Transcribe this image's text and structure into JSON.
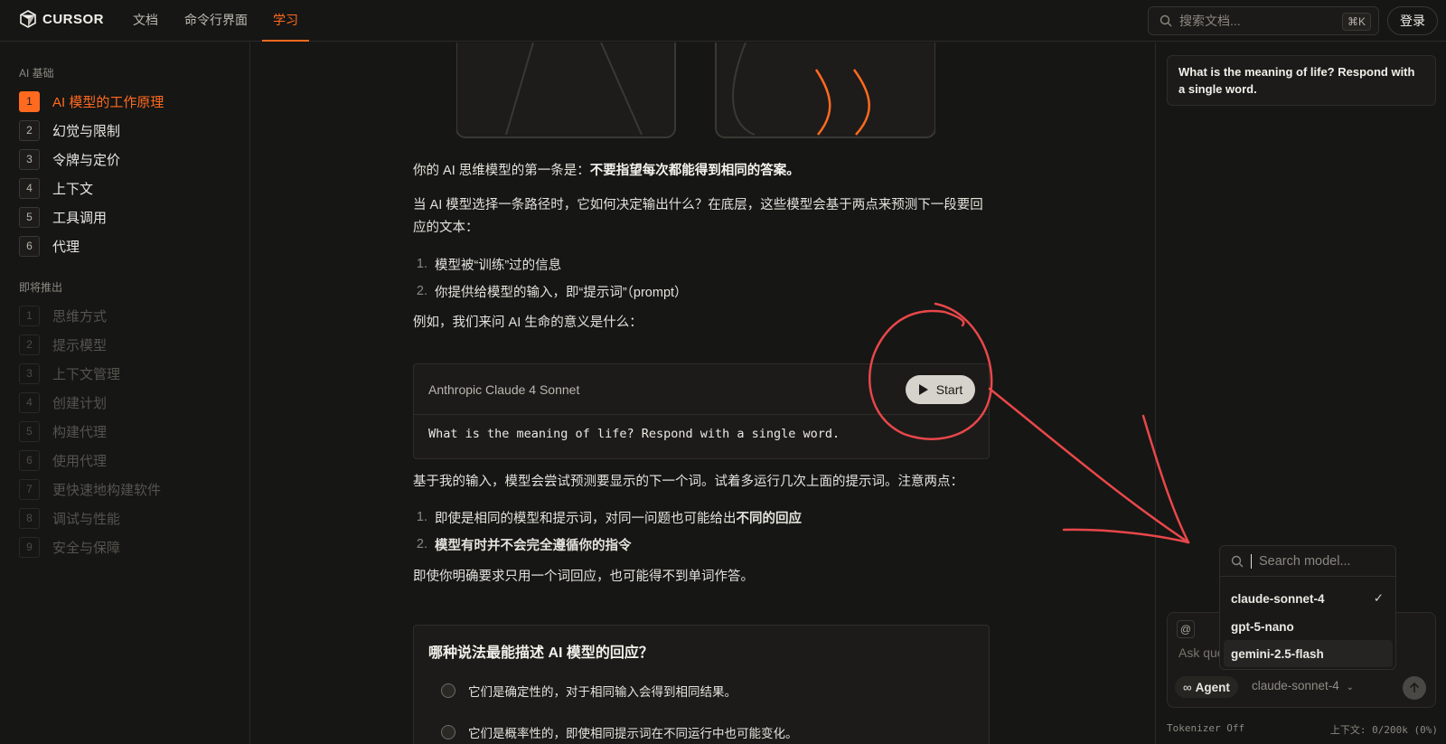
{
  "topbar": {
    "logo_text": "CURSOR",
    "nav": [
      "文档",
      "命令行界面",
      "学习"
    ],
    "active_nav": "学习",
    "search_placeholder": "搜索文档...",
    "search_shortcut": "⌘K",
    "login_label": "登录"
  },
  "sidebar": {
    "section1_title": "AI 基础",
    "section1_items": [
      {
        "num": "1",
        "label": "AI 模型的工作原理",
        "active": true
      },
      {
        "num": "2",
        "label": "幻觉与限制"
      },
      {
        "num": "3",
        "label": "令牌与定价"
      },
      {
        "num": "4",
        "label": "上下文"
      },
      {
        "num": "5",
        "label": "工具调用"
      },
      {
        "num": "6",
        "label": "代理"
      }
    ],
    "section2_title": "即将推出",
    "section2_items": [
      {
        "num": "1",
        "label": "思维方式"
      },
      {
        "num": "2",
        "label": "提示模型"
      },
      {
        "num": "3",
        "label": "上下文管理"
      },
      {
        "num": "4",
        "label": "创建计划"
      },
      {
        "num": "5",
        "label": "构建代理"
      },
      {
        "num": "6",
        "label": "使用代理"
      },
      {
        "num": "7",
        "label": "更快速地构建软件"
      },
      {
        "num": "8",
        "label": "调试与性能"
      },
      {
        "num": "9",
        "label": "安全与保障"
      }
    ]
  },
  "content": {
    "p1_prefix": "你的 AI 思维模型的第一条是：",
    "p1_bold": "不要指望每次都能得到相同的答案。",
    "p2": "当 AI 模型选择一条路径时，它如何决定输出什么？在底层，这些模型会基于两点来预测下一段要回应的文本：",
    "list1": [
      {
        "n": "1.",
        "text": "模型被“训练”过的信息"
      },
      {
        "n": "2.",
        "text": "你提供给模型的输入，即“提示词”（prompt）"
      }
    ],
    "p3": "例如，我们来问 AI 生命的意义是什么：",
    "prompt_card": {
      "model": "Anthropic Claude 4 Sonnet",
      "start_label": "Start",
      "prompt": "What is the meaning of life? Respond with a single word."
    },
    "p4": "基于我的输入，模型会尝试预测要显示的下一个词。试着多运行几次上面的提示词。注意两点：",
    "list2": [
      {
        "n": "1.",
        "text": "即使是相同的模型和提示词，对同一问题也可能给出",
        "bold": "不同的回应"
      },
      {
        "n": "2.",
        "text": "",
        "bold": "模型有时并不会完全遵循你的指令"
      }
    ],
    "p5": "即使你明确要求只用一个词回应，也可能得不到单词作答。",
    "quiz": {
      "question": "哪种说法最能描述 AI 模型的回应？",
      "options": [
        "它们是确定性的，对于相同输入会得到相同结果。",
        "它们是概率性的，即使相同提示词在不同运行中也可能变化。"
      ]
    }
  },
  "chat": {
    "user_message": "What is the meaning of life? Respond with a single word.",
    "at_symbol": "@",
    "input_placeholder": "Ask que",
    "agent_label": "Agent",
    "model_label": "claude-sonnet-4",
    "footer_left": "Tokenizer Off",
    "footer_right": "上下文:  0/200k (0%)"
  },
  "model_dropdown": {
    "search_placeholder": "Search model...",
    "models": [
      {
        "name": "claude-sonnet-4",
        "selected": true
      },
      {
        "name": "gpt-5-nano"
      },
      {
        "name": "gemini-2.5-flash"
      }
    ]
  },
  "colors": {
    "accent": "#ff6a1f",
    "annotation": "#e8474a",
    "background": "#161614"
  }
}
